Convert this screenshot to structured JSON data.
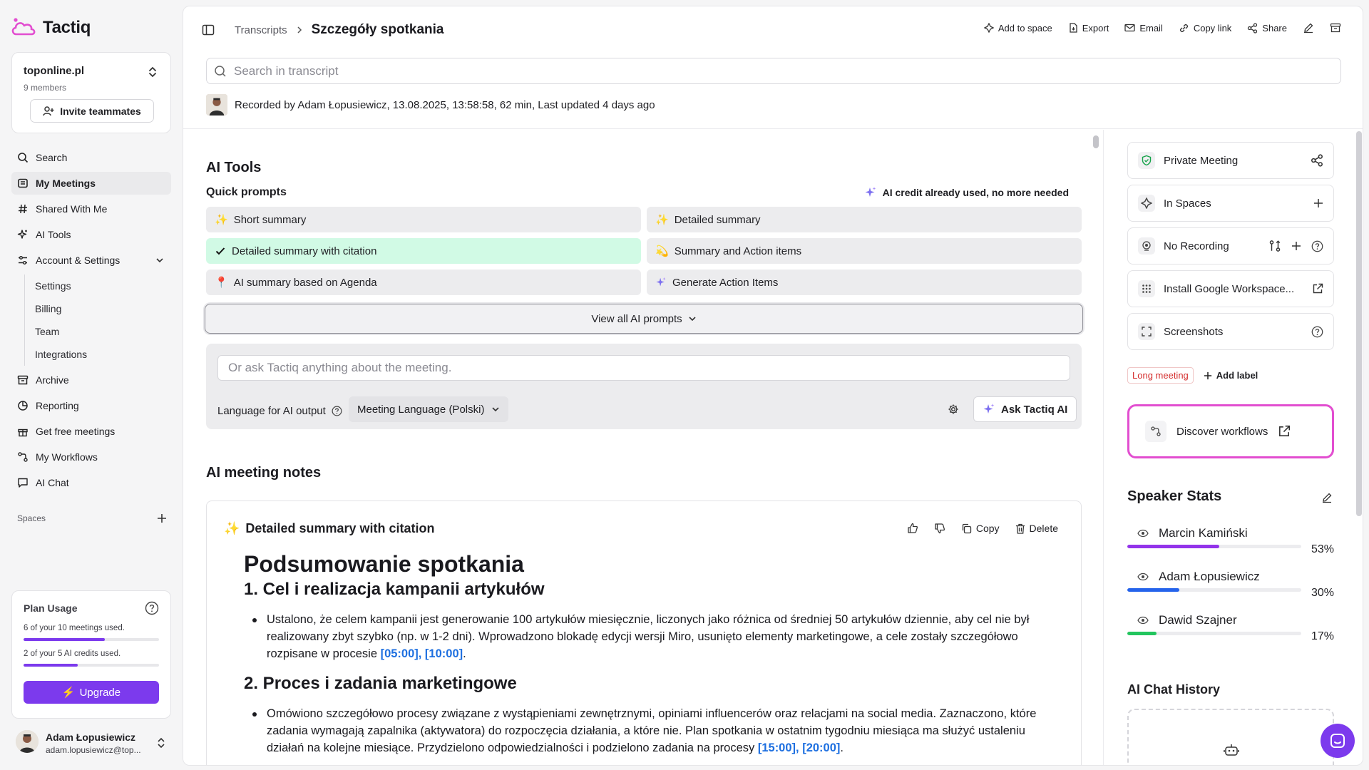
{
  "app": {
    "name": "Tactiq"
  },
  "workspace": {
    "name": "toponline.pl",
    "members": "9 members",
    "invite_label": "Invite teammates"
  },
  "nav": {
    "search": "Search",
    "my_meetings": "My Meetings",
    "shared": "Shared With Me",
    "ai_tools": "AI Tools",
    "account": "Account & Settings",
    "sub": [
      "Settings",
      "Billing",
      "Team",
      "Integrations"
    ],
    "archive": "Archive",
    "reporting": "Reporting",
    "free": "Get free meetings",
    "workflows": "My Workflows",
    "ai_chat": "AI Chat"
  },
  "spaces": {
    "label": "Spaces"
  },
  "plan": {
    "title": "Plan Usage",
    "meetings_text": "6 of your 10 meetings used.",
    "meetings_used": 0.6,
    "credits_text": "2 of your 5 AI credits used.",
    "credits_used": 0.4,
    "upgrade_label": "Upgrade"
  },
  "user": {
    "name": "Adam Łopusiewicz",
    "email": "adam.lopusiewicz@top..."
  },
  "header": {
    "breadcrumb_root": "Transcripts",
    "title": "Szczegóły spotkania",
    "actions": {
      "add_to_space": "Add to space",
      "export": "Export",
      "email": "Email",
      "copy_link": "Copy link",
      "share": "Share"
    },
    "search_placeholder": "Search in transcript",
    "recorded": "Recorded by Adam Łopusiewicz, 13.08.2025, 13:58:58, 62 min, Last updated 4 days ago"
  },
  "ai_tools": {
    "title": "AI Tools",
    "quick_prompts_label": "Quick prompts",
    "credit_note": "AI credit already used, no more needed",
    "prompts": [
      {
        "icon": "✨",
        "label": "Short summary"
      },
      {
        "icon": "✨",
        "label": "Detailed summary"
      },
      {
        "icon": "✓",
        "label": "Detailed summary with citation"
      },
      {
        "icon": "💫",
        "label": "Summary and Action items"
      },
      {
        "icon": "📍",
        "label": "AI summary based on Agenda"
      },
      {
        "icon": "✦",
        "label": "Generate Action Items"
      }
    ],
    "view_all_label": "View all AI prompts",
    "ask_placeholder": "Or ask Tactiq anything about the meeting.",
    "language_label": "Language for AI output",
    "language_value": "Meeting Language (Polski)",
    "ask_button": "Ask Tactiq AI"
  },
  "notes": {
    "title": "AI meeting notes",
    "card_title": "Detailed summary with citation",
    "copy_label": "Copy",
    "delete_label": "Delete",
    "h1": "Podsumowanie spotkania",
    "s1_title": "1. Cel i realizacja kampanii artykułów",
    "s1_text": "Ustalono, że celem kampanii jest generowanie 100 artykułów miesięcznie, liczonych jako różnica od średniej 50 artykułów dziennie, aby cel nie był realizowany zbyt szybko (np. w 1-2 dni). Wprowadzono blokadę edycji wersji Miro, usunięto elementy marketingowe, a cele zostały szczegółowo rozpisane w procesie ",
    "s1_cite": "[05:00], [10:00]",
    "s2_title": "2. Proces i zadania marketingowe",
    "s2_text": "Omówiono szczegółowo procesy związane z wystąpieniami zewnętrznymi, opiniami influencerów oraz relacjami na social media. Zaznaczono, które zadania wymagają zapalnika (aktywatora) do rozpoczęcia działania, a które nie. Plan spotkania w ostatnim tygodniu miesiąca ma służyć ustaleniu działań na kolejne miesiące. Przydzielono odpowiedzialności i podzielono zadania na procesy ",
    "s2_cite": "[15:00], [20:00]"
  },
  "right_panel": {
    "private": "Private Meeting",
    "spaces": "In Spaces",
    "recording": "No Recording",
    "install": "Install Google Workspace...",
    "screenshots": "Screenshots",
    "long_label": "Long meeting",
    "add_label": "Add label",
    "workflows": "Discover workflows",
    "stats_title": "Speaker Stats",
    "speakers": [
      {
        "name": "Marcin Kamiński",
        "pct_label": "53%",
        "pct": 53,
        "color": "#9333ea"
      },
      {
        "name": "Adam Łopusiewicz",
        "pct_label": "30%",
        "pct": 30,
        "color": "#2563eb"
      },
      {
        "name": "Dawid Szajner",
        "pct_label": "17%",
        "pct": 17,
        "color": "#22c55e"
      }
    ],
    "history_title": "AI Chat History"
  },
  "colors": {
    "accent": "#7c3aed",
    "selected": "#d1fae5",
    "citation": "#1d6fe0",
    "workflow_border": "#e24ed0",
    "long_tag": "#d42b2b"
  }
}
